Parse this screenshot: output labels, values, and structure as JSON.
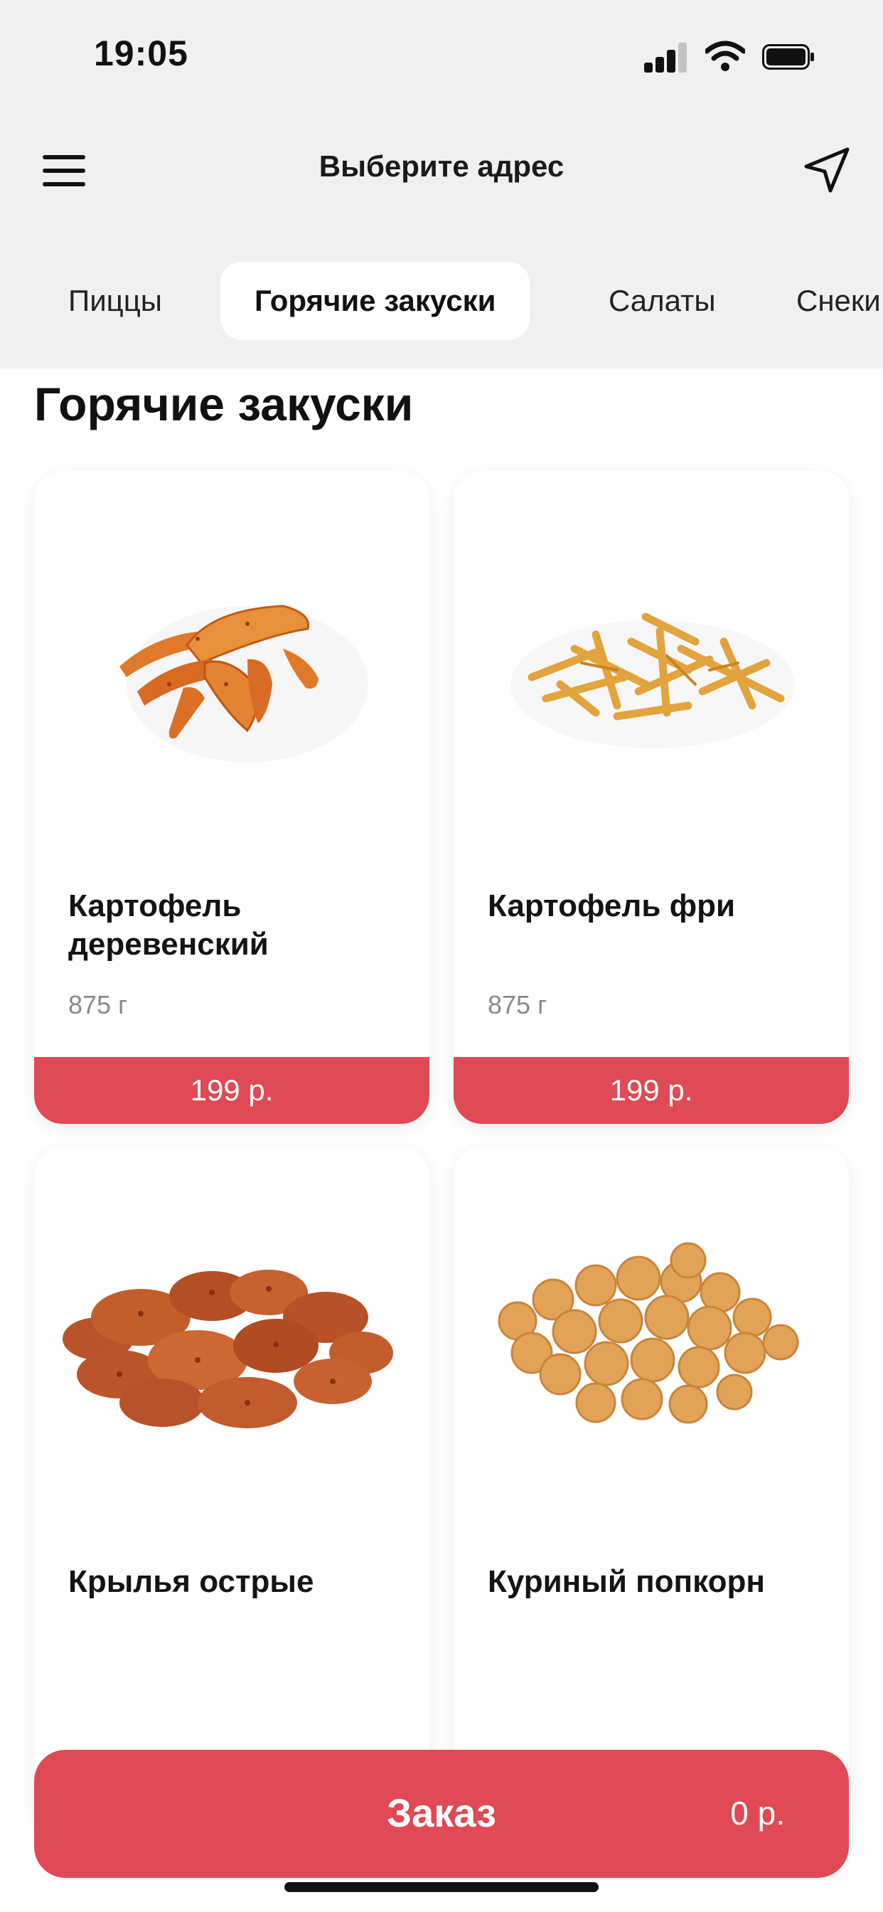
{
  "status_bar": {
    "time": "19:05"
  },
  "header": {
    "title": "Выберите адрес",
    "menu_icon": "hamburger-menu-icon",
    "location_icon": "navigation-arrow-icon"
  },
  "tabs": [
    {
      "label": "Пиццы",
      "active": false
    },
    {
      "label": "Горячие закуски",
      "active": true
    },
    {
      "label": "Салаты",
      "active": false
    },
    {
      "label": "Снеки",
      "active": false
    }
  ],
  "section": {
    "title": "Горячие закуски"
  },
  "products": [
    {
      "name": "Картофель деревенский",
      "weight": "875 г",
      "price": "199 р.",
      "image": "potato-wedges"
    },
    {
      "name": "Картофель фри",
      "weight": "875 г",
      "price": "199 р.",
      "image": "french-fries"
    },
    {
      "name": "Крылья острые",
      "image": "spicy-chicken-wings"
    },
    {
      "name": "Куриный попкорн",
      "image": "chicken-popcorn"
    }
  ],
  "order": {
    "label": "Заказ",
    "total": "0 р."
  },
  "colors": {
    "accent": "#df4a55",
    "header_bg": "#f1f0ee"
  }
}
